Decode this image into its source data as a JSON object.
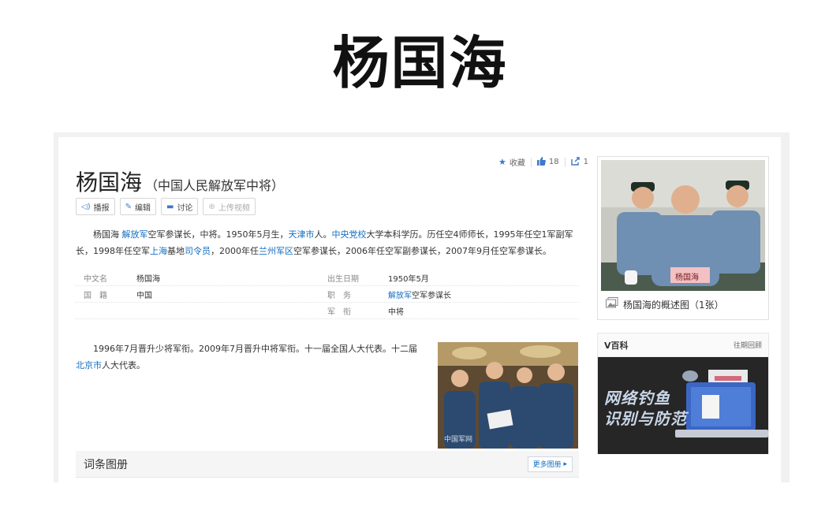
{
  "heading": "杨国海",
  "lemma": {
    "title": "杨国海",
    "subtitle": "（中国人民解放军中将）"
  },
  "actions": {
    "favorite": "收藏",
    "likes": "18",
    "shares": "1"
  },
  "toolbar": {
    "play": "播报",
    "edit": "编辑",
    "discuss": "讨论",
    "upload_video": "上传视频"
  },
  "summary": {
    "s1": "杨国海 ",
    "l1": "解放军",
    "s2": "空军参谋长，中将。1950年5月生，",
    "l2": "天津市",
    "s3": "人。",
    "l3": "中央党校",
    "s4": "大学本科学历。历任空4师师长，1995年任空1军副军长，1998年任空军",
    "l4": "上海",
    "s5": "基地",
    "l5": "司令员",
    "s6": "，2000年任",
    "l6": "兰州军区",
    "s7": "空军参谋长，2006年任空军副参谋长，2007年9月任空军参谋长。"
  },
  "info": {
    "name_label": "中文名",
    "name_value": "杨国海",
    "birth_label": "出生日期",
    "birth_value": "1950年5月",
    "nation_label": "国　籍",
    "nation_value": "中国",
    "post_label": "职　务",
    "post_link": "解放军",
    "post_rest": "空军参谋长",
    "rank_label": "军　衔",
    "rank_value": "中将"
  },
  "para2": {
    "s1": "1996年7月晋升少将军衔。2009年7月晋升中将军衔。十一届全国人大代表。十二届",
    "l1": "北京市",
    "s2": "人大代表。"
  },
  "photo_watermark": "中国军网",
  "album": {
    "title": "词条图册",
    "more": "更多图册"
  },
  "side_pic": {
    "caption": "杨国海的概述图（1张）",
    "nameplate": "杨国海"
  },
  "vbaike": {
    "title": "V百科",
    "link": "往期回顾",
    "line1": "网络钓鱼",
    "line2": "识别与防范"
  }
}
